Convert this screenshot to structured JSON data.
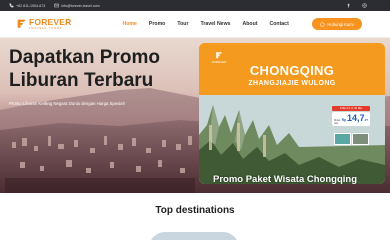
{
  "topbar": {
    "phone": "+62 811-1904-673",
    "email": "info@forever-travel.com",
    "phone_icon": "phone-icon",
    "email_icon": "mail-icon",
    "social_icons": [
      "facebook-icon",
      "instagram-icon"
    ]
  },
  "brand": {
    "name": "FOREVER",
    "tagline": "TRAVELS TOURS",
    "accent": "#f28b1e"
  },
  "nav": {
    "items": [
      {
        "label": "Home",
        "active": true
      },
      {
        "label": "Promo",
        "active": false
      },
      {
        "label": "Tour",
        "active": false
      },
      {
        "label": "Travel News",
        "active": false
      },
      {
        "label": "About",
        "active": false
      },
      {
        "label": "Contact",
        "active": false
      }
    ],
    "cta_label": "Hubungi Kami",
    "cta_icon": "whatsapp-icon"
  },
  "hero": {
    "title": "Dapatkan Promo Liburan Terbaru",
    "lead": "Promo Liburan Keliling Negara Dunia dengan Harga Spesial!"
  },
  "promo_card": {
    "brand": "FOREVER",
    "city": "CHONGQING",
    "subtitle": "ZHANGJIAJIE WULONG",
    "dates": "9 Mei 13, 8, 30 Mei",
    "from_label": "Mulai dari",
    "currency": "Rp",
    "price": "14,7",
    "price_unit": "JT",
    "caption": "Promo Paket Wisata Chongqing"
  },
  "destinations": {
    "title": "Top destinations"
  }
}
